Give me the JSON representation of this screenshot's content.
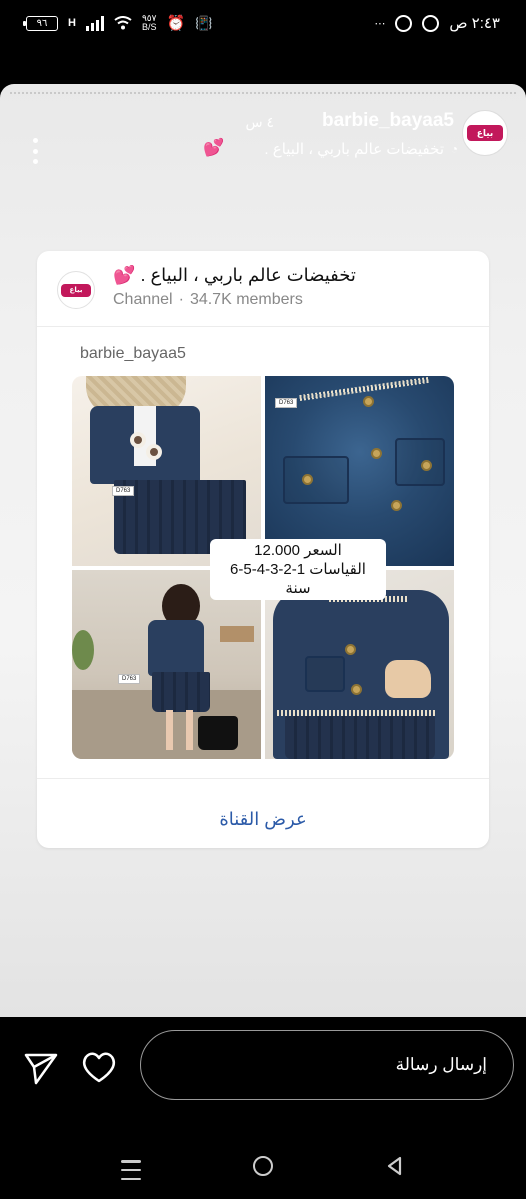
{
  "status_bar": {
    "battery": "٩٦",
    "network_type": "H",
    "net_speed_value": "٩٥٧",
    "net_speed_unit": "B/S",
    "time": "٢:٤٣ ص"
  },
  "story": {
    "username": "barbie_bayaa5",
    "time_ago": "٤ س",
    "caption": "تخفيضات عالم باربي ، البياع .",
    "caption_emoji": "💕",
    "avatar_logo_text": "بياع"
  },
  "shared_channel_card": {
    "channel_name": "تخفيضات عالم باربي ، البياع .",
    "channel_emoji": "💕",
    "channel_label": "Channel",
    "member_count": "34.7K members",
    "post_author": "barbie_bayaa5",
    "price_line": "السعر 12.000",
    "sizes_line": "القياسات 1-2-3-4-5-6 سنة",
    "product_code": "D763",
    "view_channel_label": "عرض القناة"
  },
  "reply_bar": {
    "message_placeholder": "إرسال رسالة"
  },
  "colors": {
    "accent_link": "#2b5aa8",
    "heart_pink": "#e84393",
    "logo_pink": "#c2185b"
  },
  "icons": [
    "send-icon",
    "heart-icon",
    "more-icon",
    "recent-apps-icon",
    "home-icon",
    "back-icon"
  ]
}
